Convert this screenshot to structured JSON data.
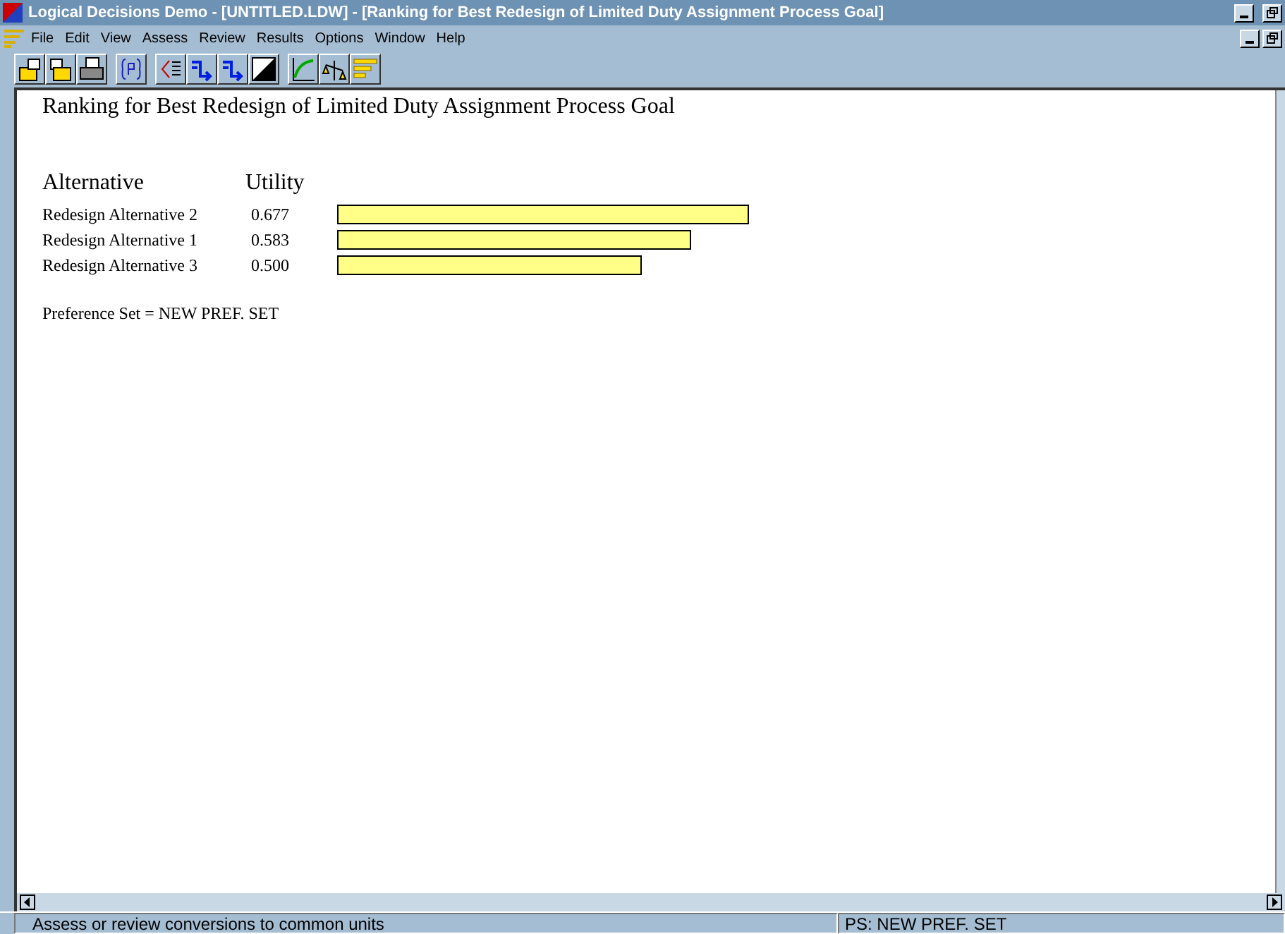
{
  "window": {
    "title": "Logical Decisions Demo - [UNTITLED.LDW] - [Ranking for Best Redesign of Limited Duty Assignment Process Goal]"
  },
  "menu": [
    "File",
    "Edit",
    "View",
    "Assess",
    "Review",
    "Results",
    "Options",
    "Window",
    "Help"
  ],
  "toolbar": [
    {
      "kind": "open"
    },
    {
      "kind": "save"
    },
    {
      "kind": "print"
    },
    {
      "kind": "pref"
    },
    {
      "kind": "list"
    },
    {
      "kind": "arrows"
    },
    {
      "kind": "arrows"
    },
    {
      "kind": "diag"
    },
    {
      "kind": "curve"
    },
    {
      "kind": "scale"
    },
    {
      "kind": "bars"
    }
  ],
  "report": {
    "title": "Ranking for Best Redesign of Limited Duty Assignment Process Goal",
    "columns": [
      "Alternative",
      "Utility"
    ],
    "rows": [
      {
        "name": "Redesign Alternative 2",
        "utility": "0.677"
      },
      {
        "name": "Redesign Alternative 1",
        "utility": "0.583"
      },
      {
        "name": "Redesign Alternative 3",
        "utility": "0.500"
      }
    ],
    "note": "Preference Set = NEW PREF. SET"
  },
  "status_bar": {
    "message": "Assess or review conversions to common units",
    "preference_set": "PS: NEW PREF. SET"
  }
}
